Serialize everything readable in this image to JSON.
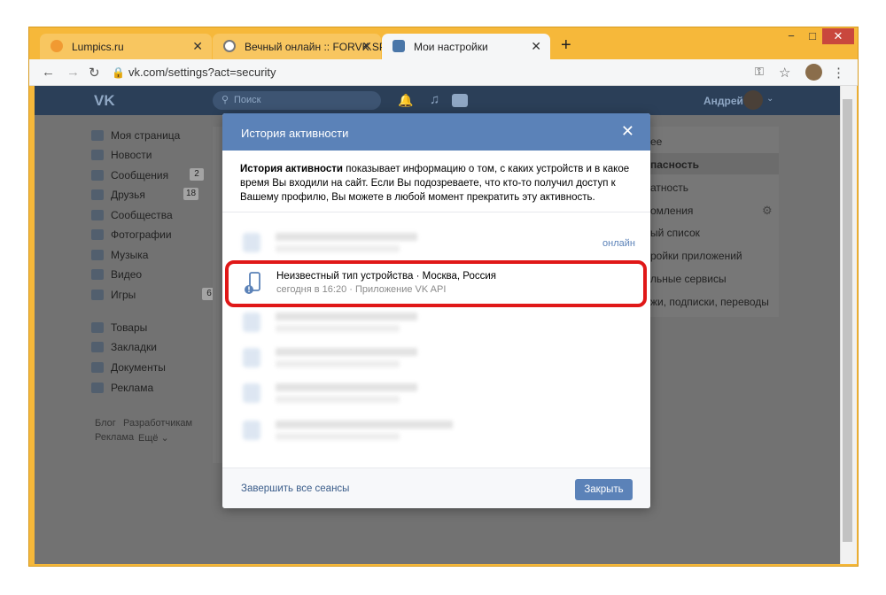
{
  "browser": {
    "tabs": [
      {
        "title": "Lumpics.ru",
        "active": false,
        "icon": "lumpics-favicon"
      },
      {
        "title": "Вечный онлайн :: FORVK.SPACE",
        "active": false,
        "icon": "forvk-favicon"
      },
      {
        "title": "Мои настройки",
        "active": true,
        "icon": "vk-favicon"
      }
    ],
    "new_tab": "+",
    "url": "vk.com/settings?act=security",
    "window_controls": [
      "−",
      "□",
      "✕"
    ]
  },
  "vk": {
    "search_placeholder": "Поиск",
    "user_name": "Андрей",
    "sidebar": [
      {
        "label": "Моя страница",
        "badge": ""
      },
      {
        "label": "Новости",
        "badge": ""
      },
      {
        "label": "Сообщения",
        "badge": "2"
      },
      {
        "label": "Друзья",
        "badge": "18"
      },
      {
        "label": "Сообщества",
        "badge": ""
      },
      {
        "label": "Фотографии",
        "badge": ""
      },
      {
        "label": "Музыка",
        "badge": ""
      },
      {
        "label": "Видео",
        "badge": ""
      },
      {
        "label": "Игры",
        "badge": "6"
      },
      {
        "label": "Товары",
        "badge": ""
      },
      {
        "label": "Закладки",
        "badge": ""
      },
      {
        "label": "Документы",
        "badge": ""
      },
      {
        "label": "Реклама",
        "badge": ""
      }
    ],
    "footer_links": [
      "Блог",
      "Разработчикам",
      "Реклама",
      "Ещё ⌄"
    ],
    "right_menu": [
      "ее",
      "пасность",
      "атность",
      "омления",
      "ый список",
      "ройки приложений",
      "льные сервисы",
      "жи, подписки, переводы"
    ]
  },
  "modal": {
    "title": "История активности",
    "desc_bold": "История активности",
    "desc_rest": " показывает информацию о том, с каких устройств и в какое время Вы входили на сайт. Если Вы подозреваете, что кто-то получил доступ к Вашему профилю, Вы можете в любой момент прекратить эту активность.",
    "online_label": "онлайн",
    "highlighted_session": {
      "device": "Неизвестный тип устройства",
      "location": "Москва, Россия",
      "time": "сегодня в 16:20",
      "app": "Приложение VK API"
    },
    "end_all_label": "Завершить все сеансы",
    "close_label": "Закрыть"
  }
}
